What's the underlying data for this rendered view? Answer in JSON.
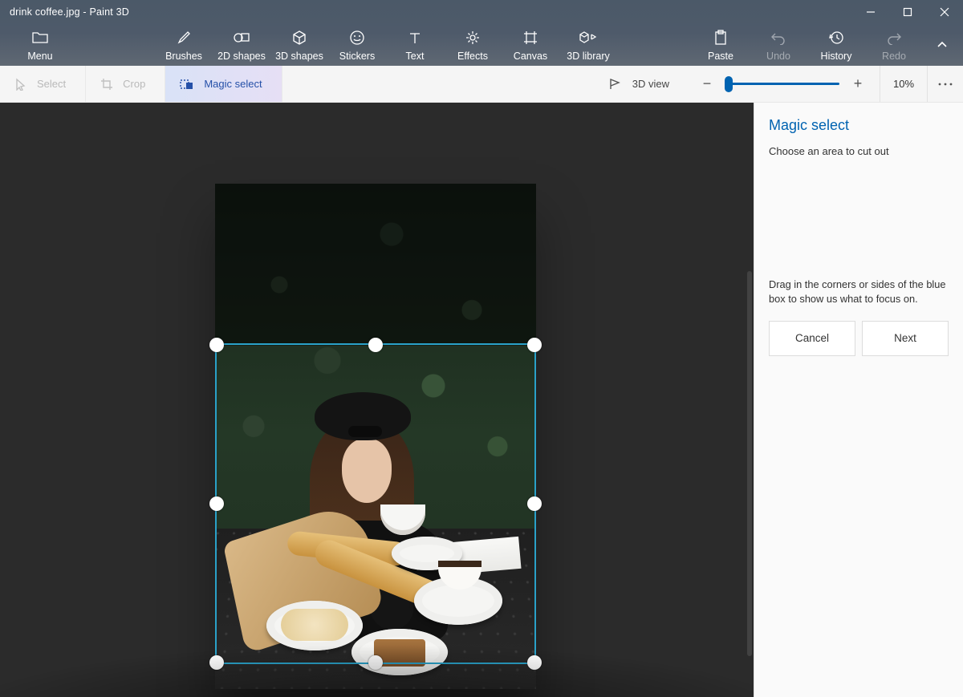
{
  "window": {
    "title": "drink coffee.jpg - Paint 3D"
  },
  "menu": {
    "label": "Menu"
  },
  "ribbon": [
    {
      "id": "brushes",
      "label": "Brushes"
    },
    {
      "id": "shapes2d",
      "label": "2D shapes"
    },
    {
      "id": "shapes3d",
      "label": "3D shapes"
    },
    {
      "id": "stickers",
      "label": "Stickers"
    },
    {
      "id": "text",
      "label": "Text"
    },
    {
      "id": "effects",
      "label": "Effects"
    },
    {
      "id": "canvas",
      "label": "Canvas"
    },
    {
      "id": "library3d",
      "label": "3D library"
    }
  ],
  "ribbon_right": [
    {
      "id": "paste",
      "label": "Paste",
      "disabled": false
    },
    {
      "id": "undo",
      "label": "Undo",
      "disabled": true
    },
    {
      "id": "history",
      "label": "History",
      "disabled": false
    },
    {
      "id": "redo",
      "label": "Redo",
      "disabled": true
    }
  ],
  "subtoolbar": {
    "select": "Select",
    "crop": "Crop",
    "magic_select": "Magic select",
    "view3d": "3D view",
    "zoom_pct": "10%"
  },
  "panel": {
    "title": "Magic select",
    "subtitle": "Choose an area to cut out",
    "help": "Drag in the corners or sides of the blue box to show us what to focus on.",
    "cancel": "Cancel",
    "next": "Next"
  }
}
